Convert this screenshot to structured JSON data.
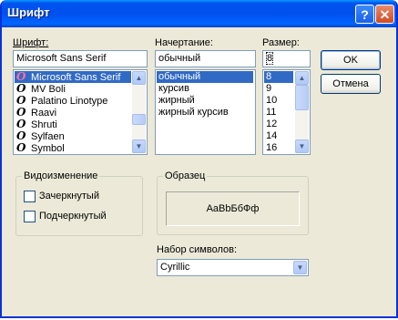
{
  "window": {
    "title": "Шрифт",
    "help_glyph": "?",
    "close_glyph": "✕"
  },
  "font": {
    "label": "Шрифт:",
    "value": "Microsoft Sans Serif",
    "items": [
      "Microsoft Sans Serif",
      "MV Boli",
      "Palatino Linotype",
      "Raavi",
      "Shruti",
      "Sylfaen",
      "Symbol"
    ],
    "selected_index": 0,
    "item_icon": "O"
  },
  "style": {
    "label": "Начертание:",
    "value": "обычный",
    "items": [
      "обычный",
      "курсив",
      "жирный",
      "жирный курсив"
    ],
    "selected_index": 0
  },
  "size": {
    "label": "Размер:",
    "value": "8",
    "items": [
      "8",
      "9",
      "10",
      "11",
      "12",
      "14",
      "16"
    ],
    "selected_index": 0
  },
  "buttons": {
    "ok": "OK",
    "cancel": "Отмена"
  },
  "effects": {
    "group_label": "Видоизменение",
    "strikeout": "Зачеркнутый",
    "underline": "Подчеркнутый",
    "strikeout_checked": false,
    "underline_checked": false
  },
  "sample": {
    "group_label": "Образец",
    "text": "AaBbБбФф"
  },
  "charset": {
    "label": "Набор символов:",
    "value": "Cyrillic"
  },
  "colors": {
    "title_bar": "#0054e3",
    "selection": "#316ac5",
    "dialog_bg": "#ece9d8"
  }
}
